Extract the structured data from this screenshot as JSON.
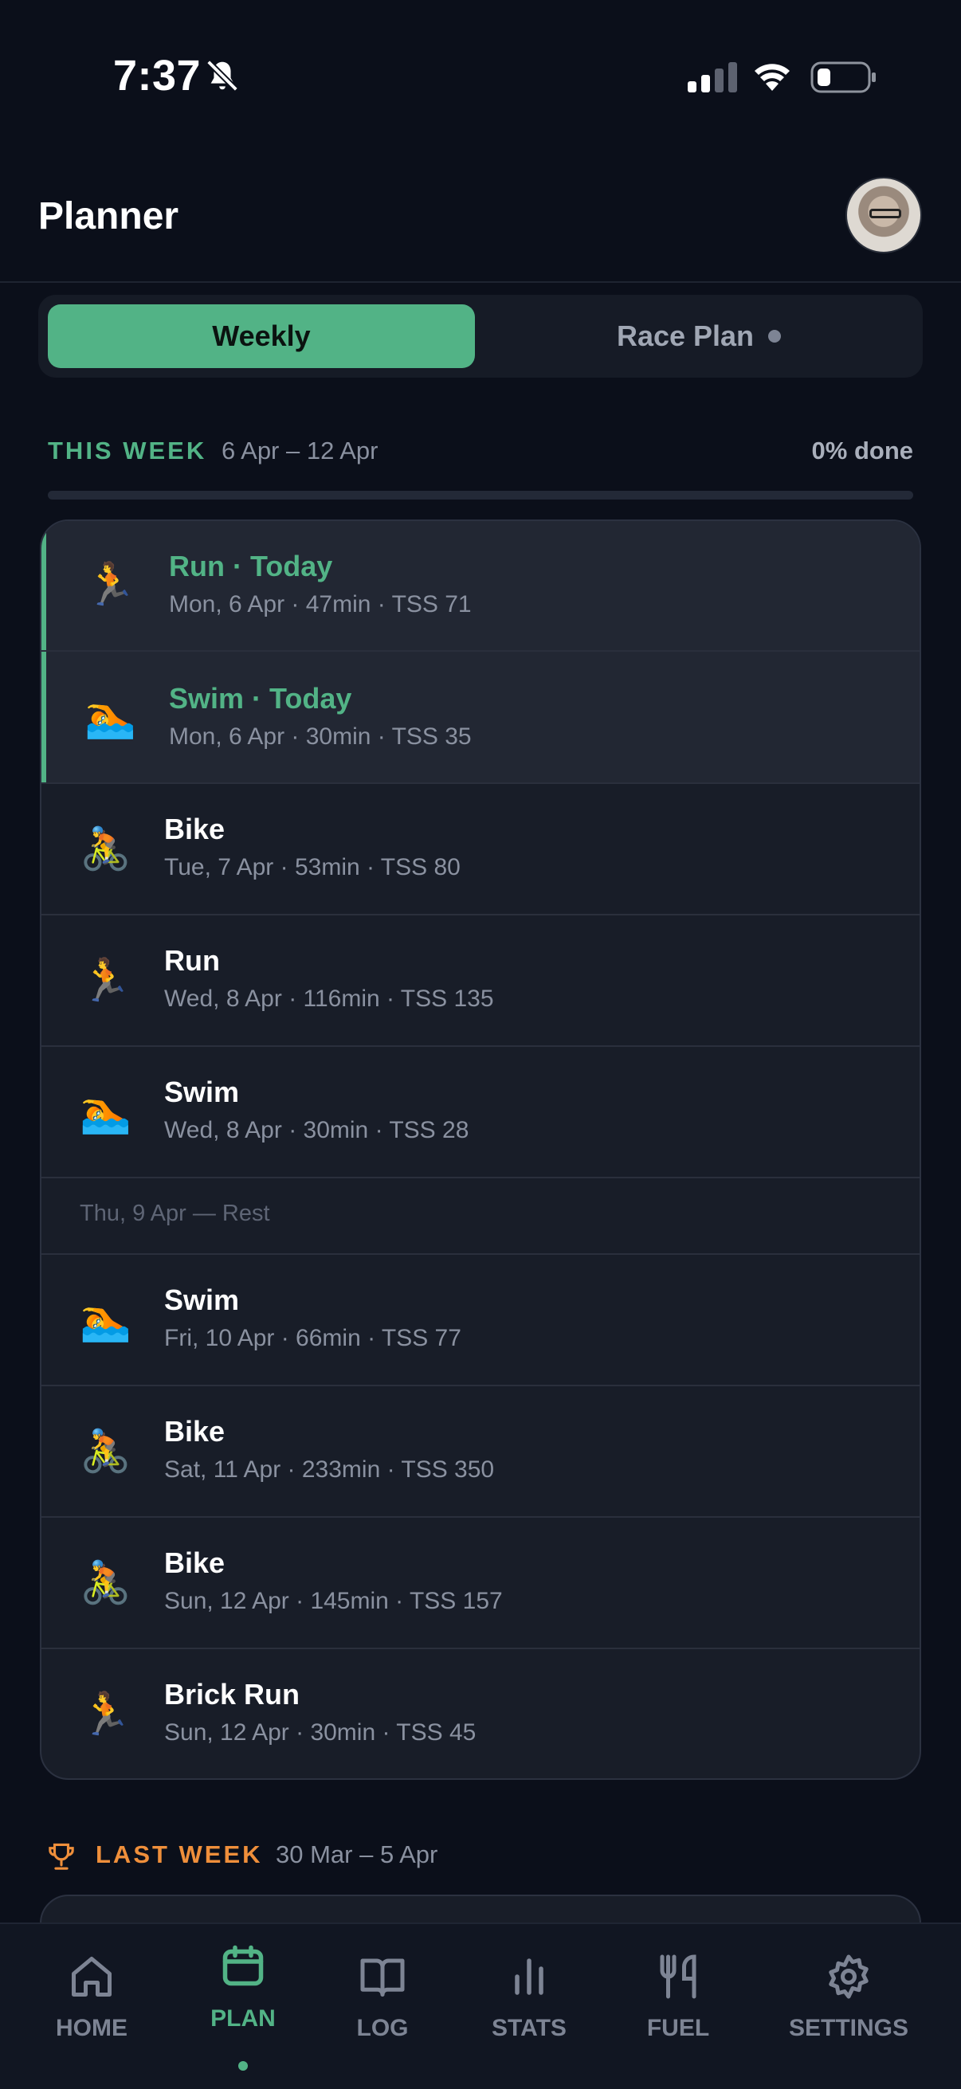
{
  "status_bar": {
    "time": "7:37"
  },
  "header": {
    "title": "Planner"
  },
  "tabs": {
    "weekly": "Weekly",
    "race_plan": "Race Plan"
  },
  "this_week": {
    "label": "THIS WEEK",
    "range": "6 Apr – 12 Apr",
    "done": "0% done",
    "progress_fraction": 0
  },
  "sessions": [
    {
      "icon": "runner-icon",
      "glyph": "🏃",
      "title": "Run · Today",
      "sub": "Mon, 6 Apr · 47min · TSS 71"
    },
    {
      "icon": "swim-icon",
      "glyph": "🏊",
      "title": "Swim · Today",
      "sub": "Mon, 6 Apr · 30min · TSS 35"
    },
    {
      "icon": "bike-icon",
      "glyph": "🚴",
      "title": "Bike",
      "sub": "Tue, 7 Apr · 53min · TSS 80"
    },
    {
      "icon": "runner-icon",
      "glyph": "🏃",
      "title": "Run",
      "sub": "Wed, 8 Apr · 116min · TSS 135"
    },
    {
      "icon": "swim-icon",
      "glyph": "🏊",
      "title": "Swim",
      "sub": "Wed, 8 Apr · 30min · TSS 28"
    },
    {
      "rest": "Thu, 9 Apr — Rest"
    },
    {
      "icon": "swim-icon",
      "glyph": "🏊",
      "title": "Swim",
      "sub": "Fri, 10 Apr · 66min · TSS 77"
    },
    {
      "icon": "bike-icon",
      "glyph": "🚴",
      "title": "Bike",
      "sub": "Sat, 11 Apr · 233min · TSS 350"
    },
    {
      "icon": "bike-icon",
      "glyph": "🚴",
      "title": "Bike",
      "sub": "Sun, 12 Apr · 145min · TSS 157"
    },
    {
      "icon": "runner-icon",
      "glyph": "🏃",
      "title": "Brick Run",
      "sub": "Sun, 12 Apr · 30min · TSS 45"
    }
  ],
  "last_week": {
    "label": "LAST WEEK",
    "range": "30 Mar – 5 Apr"
  },
  "nav": {
    "home": "HOME",
    "plan": "PLAN",
    "log": "LOG",
    "stats": "STATS",
    "fuel": "FUEL",
    "settings": "SETTINGS"
  },
  "colors": {
    "accent": "#52b386",
    "last_week": "#ef8f3b",
    "background": "#0b0f1a",
    "card": "#181d28"
  }
}
